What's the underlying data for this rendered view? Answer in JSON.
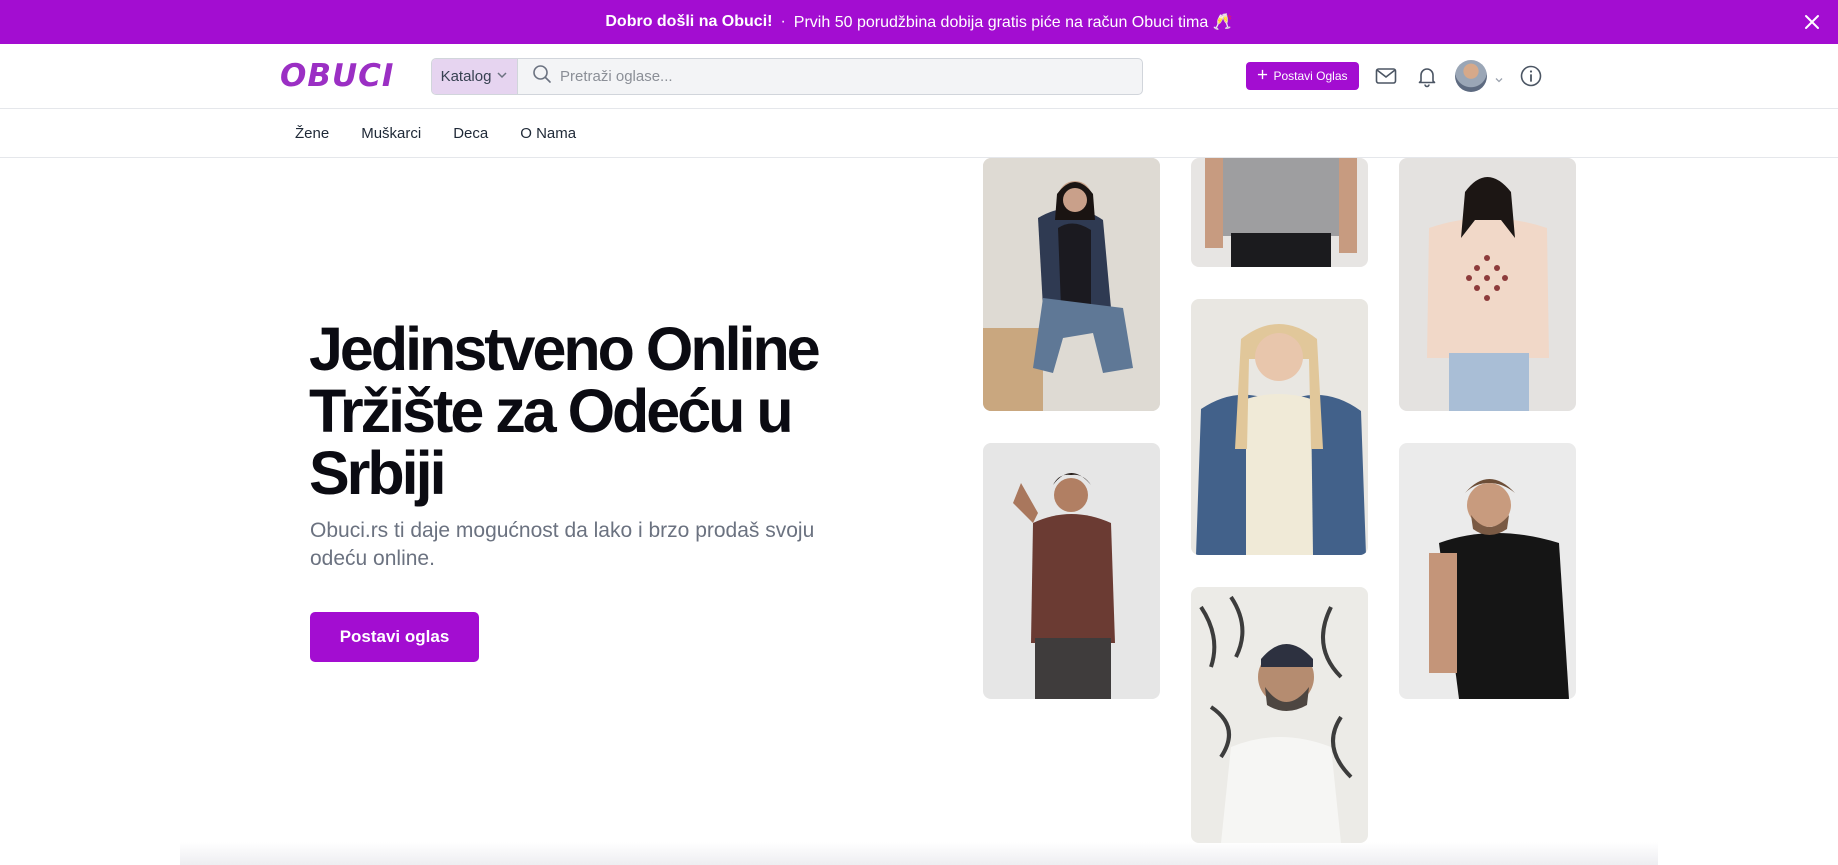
{
  "banner": {
    "welcome": "Dobro došli na Obuci!",
    "separator": "·",
    "promo": "Prvih 50 porudžbina dobija gratis piće na račun Obuci tima 🥂",
    "close_icon": "close-icon"
  },
  "header": {
    "logo": "OBUCI",
    "catalog_label": "Katalog",
    "search_placeholder": "Pretraži oglase...",
    "post_button": "Postavi Oglas",
    "icons": [
      "mail-icon",
      "bell-icon",
      "avatar",
      "info-icon"
    ]
  },
  "subnav": {
    "items": [
      {
        "label": "Žene"
      },
      {
        "label": "Muškarci"
      },
      {
        "label": "Deca"
      },
      {
        "label": "O Nama"
      }
    ]
  },
  "hero": {
    "title": "Jedinstveno Online Tržište za Odeću u Srbiji",
    "subtitle": "Obuci.rs ti daje mogućnost da lako i brzo prodaš svoju odeću online.",
    "cta": "Postavi oglas"
  },
  "colors": {
    "brand": "#a30dd1",
    "logo": "#9b2fc4"
  }
}
